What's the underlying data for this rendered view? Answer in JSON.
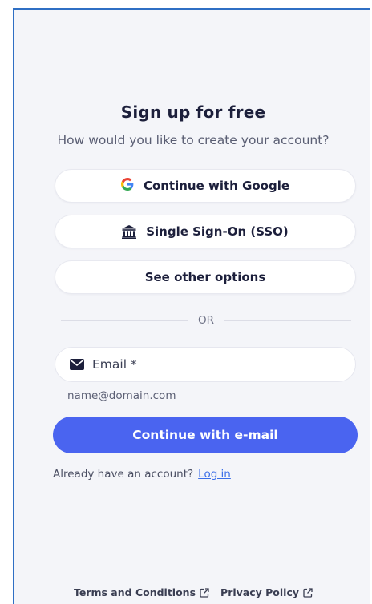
{
  "header": {
    "title": "Sign up for free",
    "subtitle": "How would you like to create your account?"
  },
  "options": {
    "google_label": "Continue with Google",
    "google_icon": "google-icon",
    "sso_label": "Single Sign-On (SSO)",
    "sso_icon": "bank-icon",
    "other_label": "See other options"
  },
  "divider": {
    "label": "OR"
  },
  "email": {
    "placeholder": "Email *",
    "icon": "mail-icon",
    "hint": "name@domain.com"
  },
  "primary_button": {
    "label": "Continue with e-mail"
  },
  "login": {
    "prompt": "Already have an account?",
    "link": "Log in"
  },
  "footer": {
    "terms": "Terms and Conditions",
    "privacy": "Privacy Policy",
    "icon": "external-link-icon"
  },
  "colors": {
    "accent": "#4a64f0",
    "link": "#3b6ee8",
    "background": "#f4f5f9",
    "frame_border": "#2f6fc4"
  }
}
